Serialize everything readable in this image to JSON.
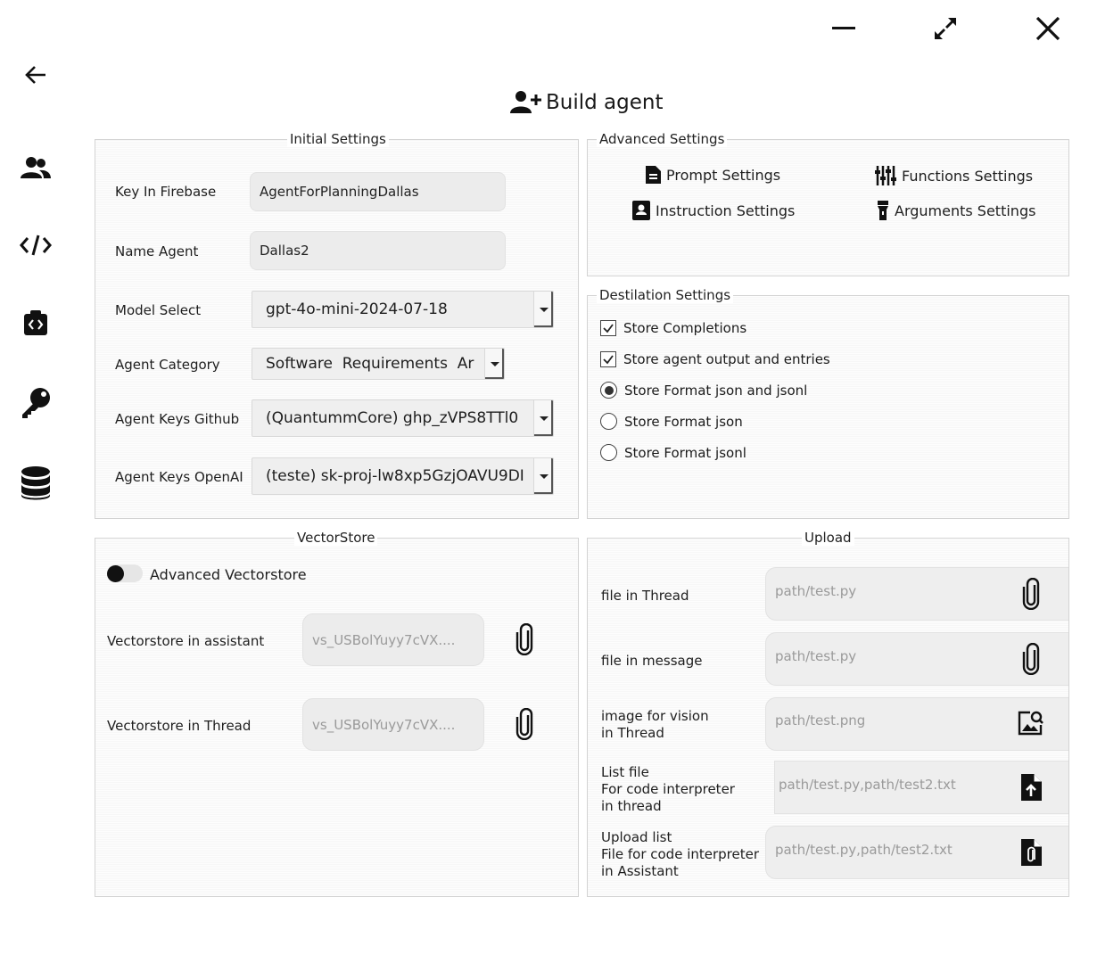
{
  "window": {
    "minimize_icon": "minimize-icon",
    "maximize_icon": "expand-icon",
    "close_icon": "close-icon"
  },
  "sidebar": {
    "items": [
      {
        "icon": "back-arrow-icon"
      },
      {
        "icon": "users-icon"
      },
      {
        "icon": "code-icon"
      },
      {
        "icon": "code-file-icon"
      },
      {
        "icon": "key-icon"
      },
      {
        "icon": "database-icon"
      }
    ]
  },
  "page": {
    "title": "Build agent",
    "title_icon": "user-plus-icon"
  },
  "initial_settings": {
    "title": "Initial Settings",
    "key_label": "Key In Firebase",
    "key_value": "AgentForPlanningDallas",
    "name_label": "Name Agent",
    "name_value": "Dallas2",
    "model_label": "Model Select",
    "model_value": "gpt-4o-mini-2024-07-18",
    "category_label": "Agent Category",
    "category_value": "Software  Requirements  Ar",
    "github_label": "Agent Keys Github",
    "github_value": "(QuantummCore) ghp_zVPS8TTl0",
    "openai_label": "Agent Keys OpenAI",
    "openai_value": "(teste) sk-proj-lw8xp5GzjOAVU9DI"
  },
  "advanced_settings": {
    "title": "Advanced Settings",
    "prompt": "Prompt Settings",
    "functions": "Functions Settings",
    "instruction": "Instruction Settings",
    "arguments": "Arguments Settings"
  },
  "destilation": {
    "title": "Destilation Settings",
    "store_completions": {
      "label": "Store Completions",
      "checked": true
    },
    "store_output": {
      "label": "Store agent output and entries",
      "checked": true
    },
    "format_both": {
      "label": "Store Format json and jsonl",
      "selected": true
    },
    "format_json": {
      "label": "Store Format json",
      "selected": false
    },
    "format_jsonl": {
      "label": "Store Format jsonl",
      "selected": false
    }
  },
  "vectorstore": {
    "title": "VectorStore",
    "advanced_label": "Advanced Vectorstore",
    "advanced_on": false,
    "assistant_label": "Vectorstore in assistant",
    "assistant_placeholder": "vs_USBolYuyy7cVX....",
    "thread_label": "Vectorstore in Thread",
    "thread_placeholder": "vs_USBolYuyy7cVX...."
  },
  "upload": {
    "title": "Upload",
    "file_thread_label": "file in Thread",
    "file_thread_placeholder": "path/test.py",
    "file_message_label": "file in message",
    "file_message_placeholder": "path/test.py",
    "image_label": "image for vision\nin Thread",
    "image_placeholder": "path/test.png",
    "list_thread_label": "List file\nFor code interpreter\nin thread",
    "list_thread_placeholder": "path/test.py,path/test2.txt",
    "list_assistant_label": "Upload list\nFile for code interpreter\nin Assistant",
    "list_assistant_placeholder": "path/test.py,path/test2.txt"
  },
  "colors": {
    "panel_border": "#d3d3d3",
    "field_bg": "#ececec",
    "icon": "#111111"
  }
}
